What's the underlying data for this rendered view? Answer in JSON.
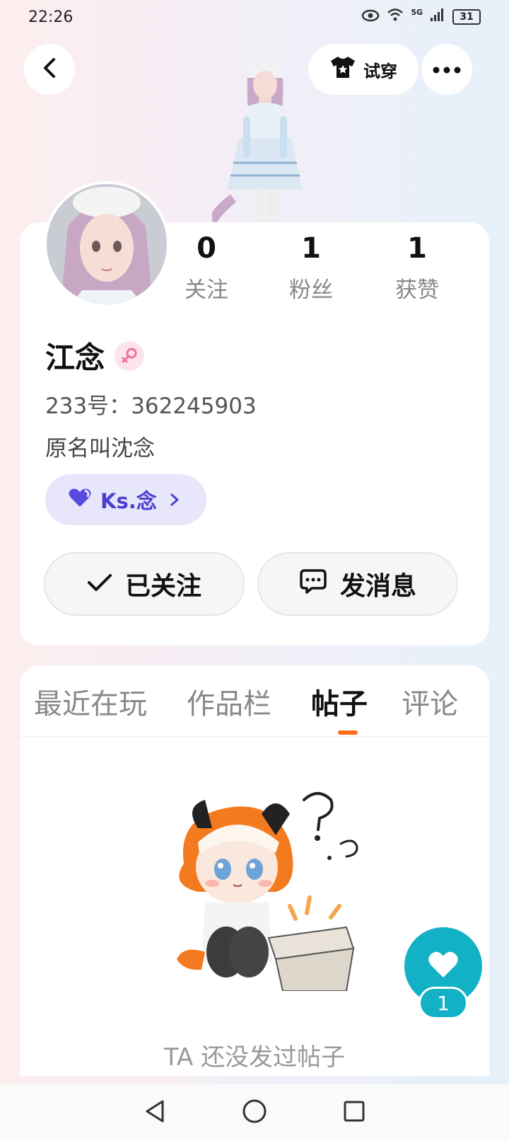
{
  "status": {
    "time": "22:26",
    "network": "5G",
    "battery": "31"
  },
  "header": {
    "try_on_label": "试穿"
  },
  "profile": {
    "name": "江念",
    "uid_label": "233号：362245903",
    "bio": "原名叫沈念",
    "guild_label": "Ks.念",
    "stats": [
      {
        "num": "0",
        "label": "关注"
      },
      {
        "num": "1",
        "label": "粉丝"
      },
      {
        "num": "1",
        "label": "获赞"
      }
    ],
    "follow_label": "已关注",
    "message_label": "发消息"
  },
  "tabs": [
    "最近在玩",
    "作品栏",
    "帖子",
    "评论"
  ],
  "active_tab": "帖子",
  "empty_text": "TA 还没发过帖子",
  "like": {
    "count": "1"
  },
  "colors": {
    "accent": "#ff6b1a",
    "like": "#12b1c6",
    "guild": "#4b3fcf"
  }
}
